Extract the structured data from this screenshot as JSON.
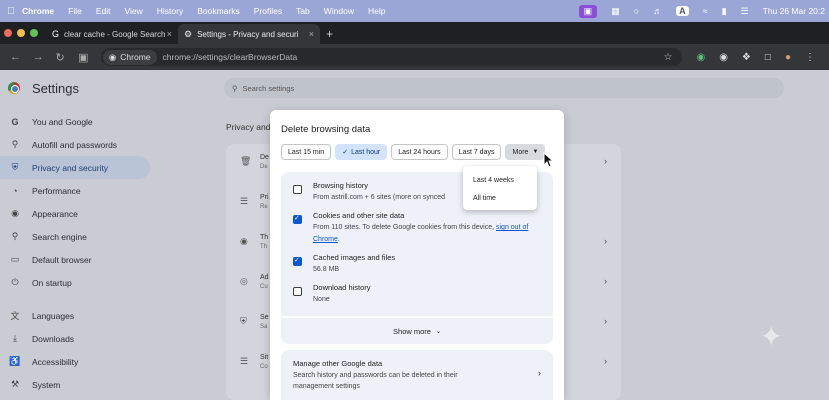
{
  "menubar": {
    "app": "Chrome",
    "items": [
      "File",
      "Edit",
      "View",
      "History",
      "Bookmarks",
      "Profiles",
      "Tab",
      "Window",
      "Help"
    ],
    "status_a": "A",
    "clock": "Thu 26 Mar  20:2"
  },
  "tabs": [
    {
      "title": "clear cache - Google Search",
      "icon": "google-icon"
    },
    {
      "title": "Settings - Privacy and securi",
      "icon": "gear-icon"
    }
  ],
  "omnibox": {
    "chip": "Chrome",
    "url": "chrome://settings/clearBrowserData"
  },
  "settings": {
    "title": "Settings",
    "search_placeholder": "Search settings",
    "section_title": "Privacy and",
    "sidebar": [
      {
        "label": "You and Google",
        "icon": "google-g-icon"
      },
      {
        "label": "Autofill and passwords",
        "icon": "key-icon"
      },
      {
        "label": "Privacy and security",
        "icon": "shield-icon",
        "active": true
      },
      {
        "label": "Performance",
        "icon": "speedometer-icon"
      },
      {
        "label": "Appearance",
        "icon": "palette-icon"
      },
      {
        "label": "Search engine",
        "icon": "search-icon"
      },
      {
        "label": "Default browser",
        "icon": "browser-icon"
      },
      {
        "label": "On startup",
        "icon": "power-icon"
      },
      {
        "label": "Languages",
        "icon": "translate-icon"
      },
      {
        "label": "Downloads",
        "icon": "download-icon"
      },
      {
        "label": "Accessibility",
        "icon": "accessibility-icon"
      },
      {
        "label": "System",
        "icon": "wrench-icon"
      }
    ],
    "rows": [
      {
        "l1": "De",
        "l2": "De"
      },
      {
        "l1": "Pri",
        "l2": "Re"
      },
      {
        "l1": "Th",
        "l2": "Th"
      },
      {
        "l1": "Ad",
        "l2": "Cu"
      },
      {
        "l1": "Se",
        "l2": "Sa"
      },
      {
        "l1": "Sit",
        "l2": "Co"
      }
    ]
  },
  "dialog": {
    "title": "Delete browsing data",
    "time_chips": [
      "Last 15 min",
      "Last hour",
      "Last 24 hours",
      "Last 7 days"
    ],
    "selected_chip": "Last hour",
    "more_label": "More",
    "dropdown": [
      "Last 4 weeks",
      "All time"
    ],
    "options": [
      {
        "title": "Browsing history",
        "desc": "From astrill.com + 6 sites (more on synced",
        "link": "",
        "after": "",
        "checked": false
      },
      {
        "title": "Cookies and other site data",
        "desc": "From 110 sites. To delete Google cookies from this device, ",
        "link": "sign out of Chrome",
        "after": ".",
        "checked": true
      },
      {
        "title": "Cached images and files",
        "desc": "56.8 MB",
        "link": "",
        "after": "",
        "checked": true
      },
      {
        "title": "Download history",
        "desc": "None",
        "link": "",
        "after": "",
        "checked": false
      }
    ],
    "show_more": "Show more",
    "manage": {
      "title": "Manage other Google data",
      "desc": "Search history and passwords can be deleted in their management settings"
    }
  }
}
